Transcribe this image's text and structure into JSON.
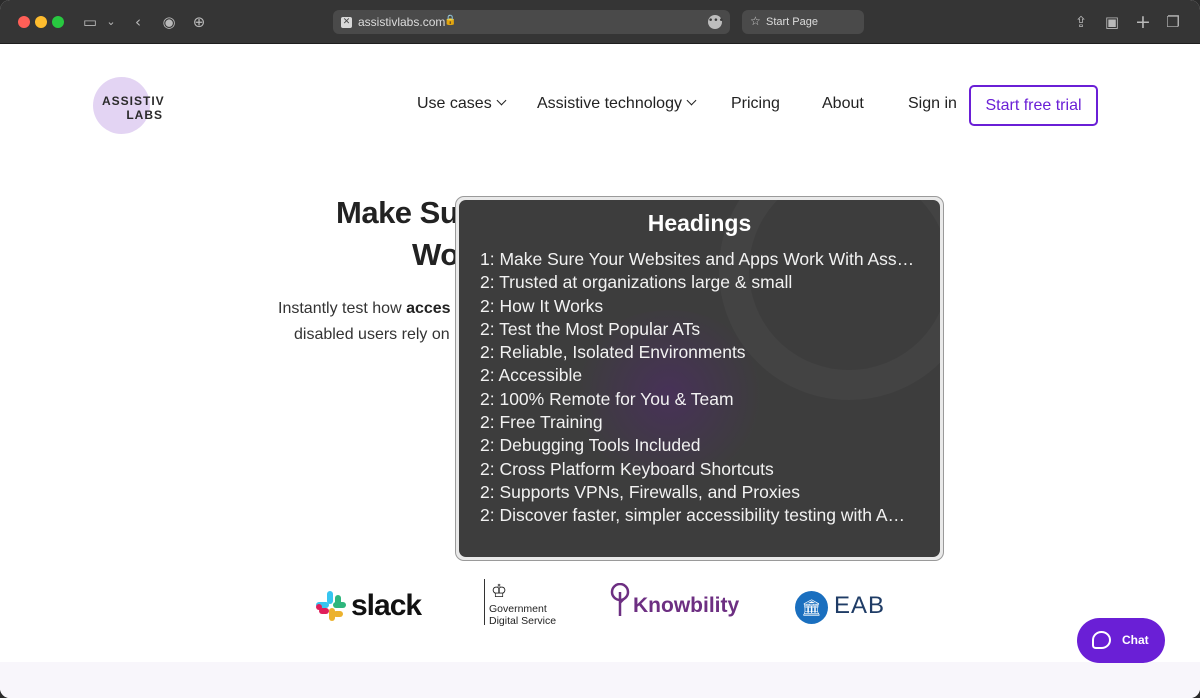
{
  "browser": {
    "url": "assistivlabs.com",
    "second_tab": "Start Page"
  },
  "site": {
    "logo_line1": "ASSISTIV",
    "logo_line2": "LABS",
    "nav": {
      "use_cases": "Use cases",
      "assistive_technology": "Assistive technology",
      "pricing": "Pricing",
      "about": "About",
      "sign_in": "Sign in",
      "start_trial": "Start free trial"
    },
    "hero": {
      "title_line1": "Make Su",
      "title_line2": "Wo",
      "text_line1_pre": "Instantly test how ",
      "text_line1_bold": "acces",
      "text_line2": "disabled users rely on"
    },
    "logos": {
      "slack": "slack",
      "gds_line1": "Government",
      "gds_line2": "Digital Service",
      "knowbility": "Knowbility",
      "eab": "EAB"
    },
    "chat_label": "Chat"
  },
  "headings_overlay": {
    "title": "Headings",
    "items": [
      "1: Make Sure Your Websites and Apps Work With Ass…",
      "2: Trusted at organizations large & small",
      "2: How It Works",
      "2: Test the Most Popular ATs",
      "2: Reliable, Isolated Environments",
      "2: Accessible",
      "2: 100% Remote for You & Team",
      "2: Free Training",
      "2: Debugging Tools Included",
      "2: Cross Platform Keyboard Shortcuts",
      "2: Supports VPNs, Firewalls, and Proxies",
      "2: Discover faster, simpler accessibility testing with A…"
    ]
  },
  "colors": {
    "brand_purple": "#6a1fd6",
    "overlay_bg": "#3d3d3d"
  }
}
